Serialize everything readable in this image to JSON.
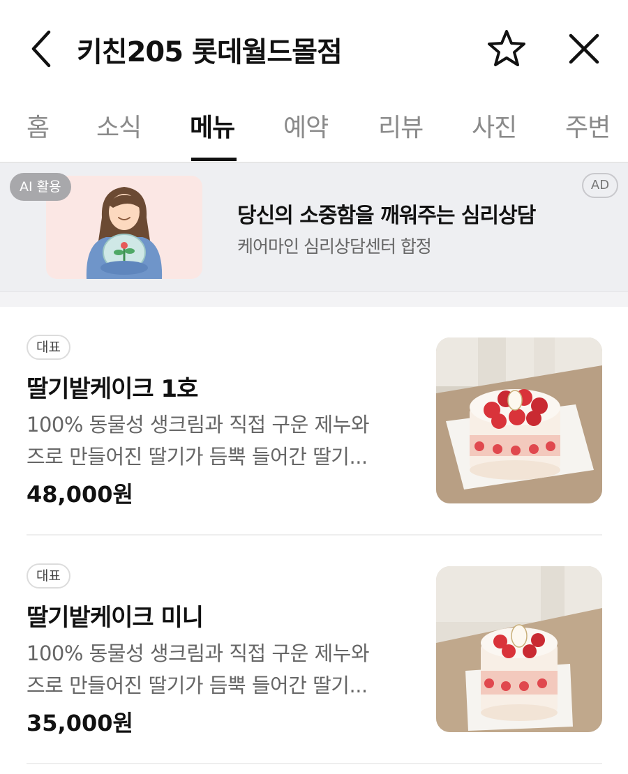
{
  "header": {
    "title": "키친205 롯데월드몰점"
  },
  "tabs": [
    {
      "label": "홈",
      "active": false
    },
    {
      "label": "소식",
      "active": false
    },
    {
      "label": "메뉴",
      "active": true
    },
    {
      "label": "예약",
      "active": false
    },
    {
      "label": "리뷰",
      "active": false
    },
    {
      "label": "사진",
      "active": false
    },
    {
      "label": "주변",
      "active": false
    }
  ],
  "ad": {
    "ai_badge": "AI 활용",
    "ad_label": "AD",
    "title": "당신의 소중함을 깨워주는 심리상담",
    "subtitle": "케어마인 심리상담센터 합정"
  },
  "menu": {
    "items": [
      {
        "badge": "대표",
        "name": "딸기밭케이크 1호",
        "desc_line1": "100% 동물성 생크림과 직접 구운 제누와",
        "desc_line2": "즈로 만들어진 딸기가 듬뿍 들어간 딸기...",
        "price": "48,000원"
      },
      {
        "badge": "대표",
        "name": "딸기밭케이크 미니",
        "desc_line1": "100% 동물성 생크림과 직접 구운 제누와",
        "desc_line2": "즈로 만들어진 딸기가 듬뿍 들어간 딸기...",
        "price": "35,000원"
      }
    ]
  },
  "colors": {
    "text_primary": "#111111",
    "text_secondary": "#666666",
    "tab_inactive": "#8a8a8a",
    "ad_background": "#eeeff2",
    "ai_badge": "#a8a8ab"
  },
  "icons": {
    "back": "chevron-left-icon",
    "favorite": "star-outline-icon",
    "close": "close-icon"
  }
}
